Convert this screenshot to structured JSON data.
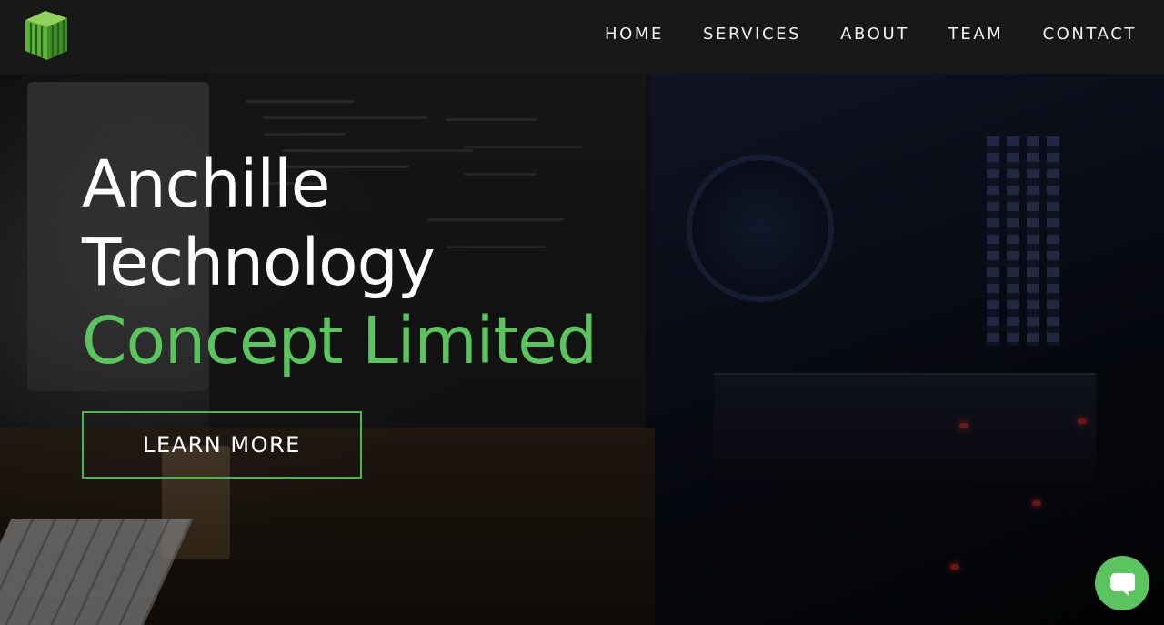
{
  "nav": {
    "logo_icon": "green-cube-logo-icon",
    "items": [
      {
        "label": "HOME"
      },
      {
        "label": "SERVICES"
      },
      {
        "label": "ABOUT"
      },
      {
        "label": "TEAM"
      },
      {
        "label": "CONTACT"
      }
    ]
  },
  "hero": {
    "title_line1": "Anchille",
    "title_line2": "Technology",
    "title_line3": "Concept Limited",
    "cta_label": "LEARN MORE"
  },
  "chat": {
    "icon": "chat-bubble-icon"
  },
  "colors": {
    "accent": "#5bc45f",
    "text": "#ffffff",
    "nav_background": "rgba(30,30,30,0.55)"
  }
}
